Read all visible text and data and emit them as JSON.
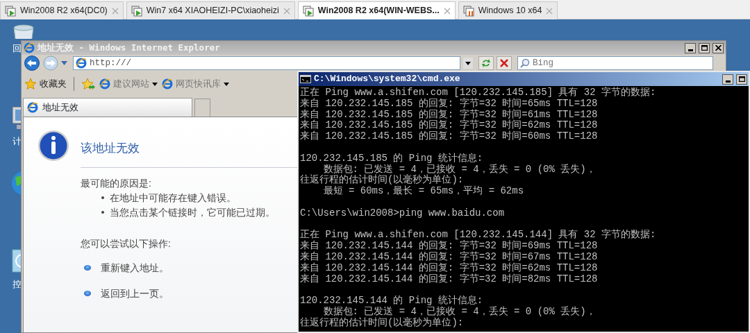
{
  "vm_tabs": [
    {
      "label": "Win2008 R2 x64(DC0)",
      "selected": false,
      "running": true
    },
    {
      "label": "Win7 x64 XIAOHEIZI-PC\\xiaoheizi",
      "selected": false,
      "running": true
    },
    {
      "label": "Win2008 R2 x64(WIN-WEBS...",
      "selected": true,
      "running": true
    },
    {
      "label": "Windows 10 x64",
      "selected": false,
      "running": false
    }
  ],
  "desktop_icons": [
    {
      "kind": "recycle",
      "label": "回"
    },
    {
      "kind": "computer",
      "label": "计"
    },
    {
      "kind": "globe"
    },
    {
      "kind": "control",
      "label": "控"
    }
  ],
  "ie": {
    "title": "地址无效 - Windows Internet Explorer",
    "address": "http:///",
    "search": {
      "placeholder": "Bing"
    },
    "favorites": "收藏夹",
    "favorite_links": [
      {
        "label": "建议网站"
      },
      {
        "label": "网页快讯库"
      }
    ],
    "tabs": [
      {
        "label": "地址无效",
        "selected": true
      }
    ],
    "page": {
      "heading": "该地址无效",
      "causes_title": "最可能的原因是:",
      "causes": [
        "在地址中可能存在键入错误。",
        "当您点击某个链接时，它可能已过期。"
      ],
      "actions_title": "您可以尝试以下操作:",
      "actions": [
        "重新键入地址。",
        "返回到上一页。"
      ]
    }
  },
  "cmd": {
    "title": "C:\\Windows\\system32\\cmd.exe",
    "blocks": [
      [
        "正在 Ping www.a.shifen.com [120.232.145.185] 具有 32 字节的数据:",
        "来自 120.232.145.185 的回复: 字节=32 时间=65ms TTL=128",
        "来自 120.232.145.185 的回复: 字节=32 时间=61ms TTL=128",
        "来自 120.232.145.185 的回复: 字节=32 时间=62ms TTL=128",
        "来自 120.232.145.185 的回复: 字节=32 时间=60ms TTL=128"
      ],
      [
        "120.232.145.185 的 Ping 统计信息:",
        "    数据包: 已发送 = 4，已接收 = 4，丢失 = 0 (0% 丢失)，",
        "往返行程的估计时间(以毫秒为单位):",
        "    最短 = 60ms，最长 = 65ms，平均 = 62ms"
      ],
      [
        "C:\\Users\\win2008>ping www.baidu.com"
      ],
      [
        "正在 Ping www.a.shifen.com [120.232.145.144] 具有 32 字节的数据:",
        "来自 120.232.145.144 的回复: 字节=32 时间=69ms TTL=128",
        "来自 120.232.145.144 的回复: 字节=32 时间=67ms TTL=128",
        "来自 120.232.145.144 的回复: 字节=32 时间=62ms TTL=128",
        "来自 120.232.145.144 的回复: 字节=32 时间=82ms TTL=128"
      ],
      [
        "120.232.145.144 的 Ping 统计信息:",
        "    数据包: 已发送 = 4，已接收 = 4，丢失 = 0 (0% 丢失)，",
        "往返行程的估计时间(以毫秒为单位):"
      ]
    ]
  }
}
